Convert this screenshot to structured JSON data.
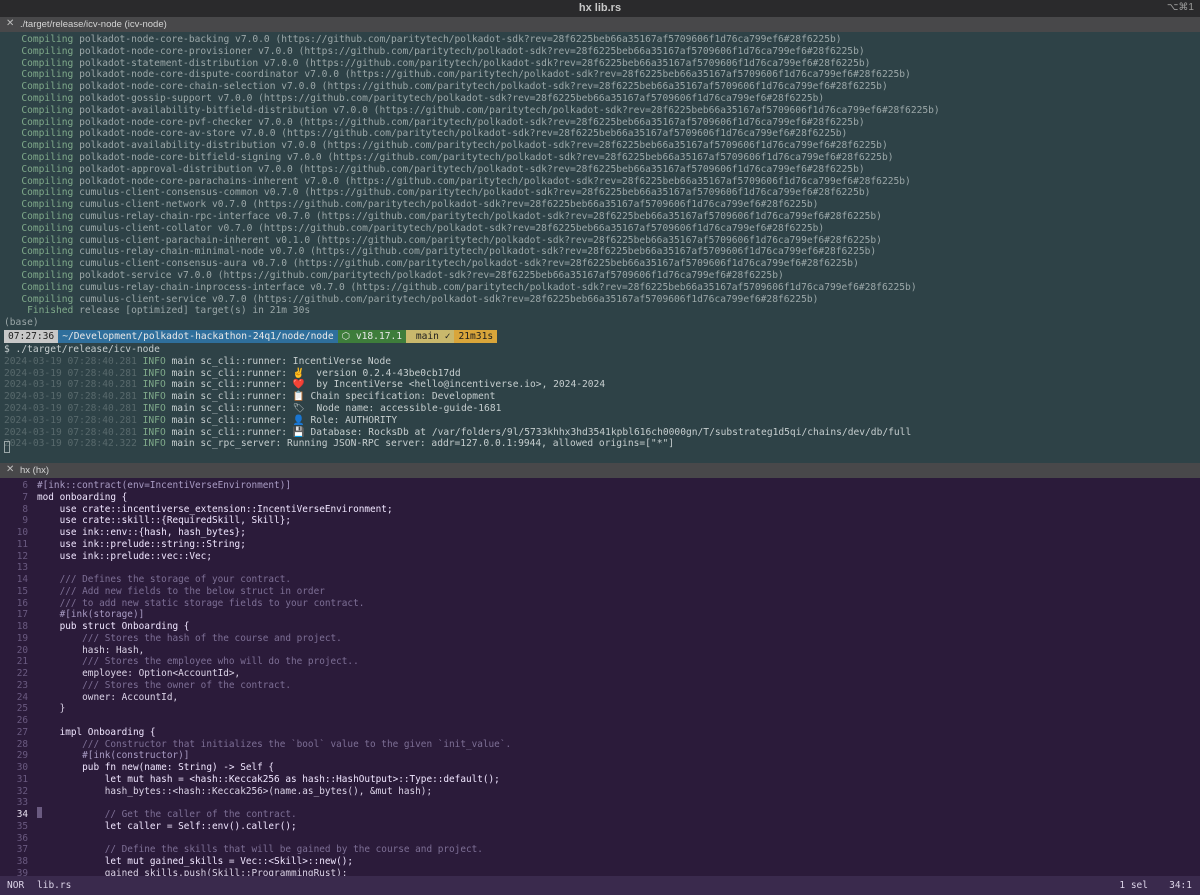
{
  "window": {
    "title": "hx lib.rs",
    "shortcut": "⌥⌘1"
  },
  "tabs": [
    {
      "label": "./target/release/icv-node (icv-node)"
    },
    {
      "label": "hx (hx)"
    }
  ],
  "terminal": {
    "compile_url": "(https://github.com/paritytech/polkadot-sdk?rev=28f6225beb66a35167af5709606f1d76ca799ef6#28f6225b)",
    "compiling": [
      "polkadot-node-core-backing v7.0.0",
      "polkadot-node-core-provisioner v7.0.0",
      "polkadot-statement-distribution v7.0.0",
      "polkadot-node-core-dispute-coordinator v7.0.0",
      "polkadot-node-core-chain-selection v7.0.0",
      "polkadot-gossip-support v7.0.0",
      "polkadot-availability-bitfield-distribution v7.0.0",
      "polkadot-node-core-pvf-checker v7.0.0",
      "polkadot-node-core-av-store v7.0.0",
      "polkadot-availability-distribution v7.0.0",
      "polkadot-node-core-bitfield-signing v7.0.0",
      "polkadot-approval-distribution v7.0.0",
      "polkadot-node-core-parachains-inherent v7.0.0",
      "cumulus-client-consensus-common v0.7.0",
      "cumulus-client-network v0.7.0",
      "cumulus-relay-chain-rpc-interface v0.7.0",
      "cumulus-client-collator v0.7.0",
      "cumulus-client-parachain-inherent v0.1.0",
      "cumulus-relay-chain-minimal-node v0.7.0",
      "cumulus-client-consensus-aura v0.7.0",
      "polkadot-service v7.0.0",
      "cumulus-relay-chain-inprocess-interface v0.7.0",
      "cumulus-client-service v0.7.0"
    ],
    "compiling_word": "Compiling",
    "finished_word": "Finished",
    "finished_rest": "release [optimized] target(s) in 21m 30s",
    "base": "(base)",
    "prompt": {
      "time": "07:27:36",
      "path": "~/Development/polkadot-hackathon-24q1/node/node",
      "node": "⬡ v18.17.1",
      "git": " main ✓",
      "duration": "21m31s"
    },
    "command": "$ ./target/release/icv-node",
    "logs": [
      {
        "ts": "2024-03-19 07:28:40.281",
        "msg": "main sc_cli::runner: IncentiVerse Node"
      },
      {
        "ts": "2024-03-19 07:28:40.281",
        "msg": "main sc_cli::runner: ✌️  version 0.2.4-43be0cb17dd"
      },
      {
        "ts": "2024-03-19 07:28:40.281",
        "msg": "main sc_cli::runner: ❤️  by IncentiVerse <hello@incentiverse.io>, 2024-2024"
      },
      {
        "ts": "2024-03-19 07:28:40.281",
        "msg": "main sc_cli::runner: 📋 Chain specification: Development"
      },
      {
        "ts": "2024-03-19 07:28:40.281",
        "msg": "main sc_cli::runner: 🏷  Node name: accessible-guide-1681"
      },
      {
        "ts": "2024-03-19 07:28:40.281",
        "msg": "main sc_cli::runner: 👤 Role: AUTHORITY"
      },
      {
        "ts": "2024-03-19 07:28:40.281",
        "msg": "main sc_cli::runner: 💾 Database: RocksDb at /var/folders/9l/5733khhx3hd3541kpbl616ch0000gn/T/substrateg1d5qi/chains/dev/db/full"
      },
      {
        "ts": "2024-03-19 07:28:42.322",
        "msg": "main sc_rpc_server: Running JSON-RPC server: addr=127.0.0.1:9944, allowed origins=[\"*\"]"
      }
    ],
    "log_level": "INFO"
  },
  "editor": {
    "current_line": 34,
    "lines": [
      {
        "n": "6",
        "t": "#[ink::contract(env=IncentiVerseEnvironment)]",
        "k": "attr"
      },
      {
        "n": "7",
        "t": "mod onboarding {",
        "k": "kw"
      },
      {
        "n": "8",
        "t": "    use crate::incentiverse_extension::IncentiVerseEnvironment;",
        "k": "kw"
      },
      {
        "n": "9",
        "t": "    use crate::skill::{RequiredSkill, Skill};",
        "k": "kw"
      },
      {
        "n": "10",
        "t": "    use ink::env::{hash, hash_bytes};",
        "k": "kw"
      },
      {
        "n": "11",
        "t": "    use ink::prelude::string::String;",
        "k": "kw"
      },
      {
        "n": "12",
        "t": "    use ink::prelude::vec::Vec;",
        "k": "kw"
      },
      {
        "n": "13",
        "t": "",
        "k": ""
      },
      {
        "n": "14",
        "t": "    /// Defines the storage of your contract.",
        "k": "com"
      },
      {
        "n": "15",
        "t": "    /// Add new fields to the below struct in order",
        "k": "com"
      },
      {
        "n": "16",
        "t": "    /// to add new static storage fields to your contract.",
        "k": "com"
      },
      {
        "n": "17",
        "t": "    #[ink(storage)]",
        "k": "attr"
      },
      {
        "n": "18",
        "t": "    pub struct Onboarding {",
        "k": "kw"
      },
      {
        "n": "19",
        "t": "        /// Stores the hash of the course and project.",
        "k": "com"
      },
      {
        "n": "20",
        "t": "        hash: Hash,",
        "k": ""
      },
      {
        "n": "21",
        "t": "        /// Stores the employee who will do the project..",
        "k": "com"
      },
      {
        "n": "22",
        "t": "        employee: Option<AccountId>,",
        "k": ""
      },
      {
        "n": "23",
        "t": "        /// Stores the owner of the contract.",
        "k": "com"
      },
      {
        "n": "24",
        "t": "        owner: AccountId,",
        "k": ""
      },
      {
        "n": "25",
        "t": "    }",
        "k": ""
      },
      {
        "n": "26",
        "t": "",
        "k": ""
      },
      {
        "n": "27",
        "t": "    impl Onboarding {",
        "k": "kw"
      },
      {
        "n": "28",
        "t": "        /// Constructor that initializes the `bool` value to the given `init_value`.",
        "k": "com"
      },
      {
        "n": "29",
        "t": "        #[ink(constructor)]",
        "k": "attr"
      },
      {
        "n": "30",
        "t": "        pub fn new(name: String) -> Self {",
        "k": "kw"
      },
      {
        "n": "31",
        "t": "            let mut hash = <hash::Keccak256 as hash::HashOutput>::Type::default();",
        "k": "kw"
      },
      {
        "n": "32",
        "t": "            hash_bytes::<hash::Keccak256>(name.as_bytes(), &mut hash);",
        "k": ""
      },
      {
        "n": "33",
        "t": "",
        "k": ""
      },
      {
        "n": "34",
        "t": "            // Get the caller of the contract.",
        "k": "com"
      },
      {
        "n": "35",
        "t": "            let caller = Self::env().caller();",
        "k": "kw"
      },
      {
        "n": "36",
        "t": "",
        "k": ""
      },
      {
        "n": "37",
        "t": "            // Define the skills that will be gained by the course and project.",
        "k": "com"
      },
      {
        "n": "38",
        "t": "            let mut gained_skills = Vec::<Skill>::new();",
        "k": "kw"
      },
      {
        "n": "39",
        "t": "            gained_skills.push(Skill::ProgrammingRust);",
        "k": ""
      }
    ]
  },
  "status": {
    "mode": "NOR",
    "file": "lib.rs",
    "selection": "1 sel",
    "position": "34:1"
  }
}
